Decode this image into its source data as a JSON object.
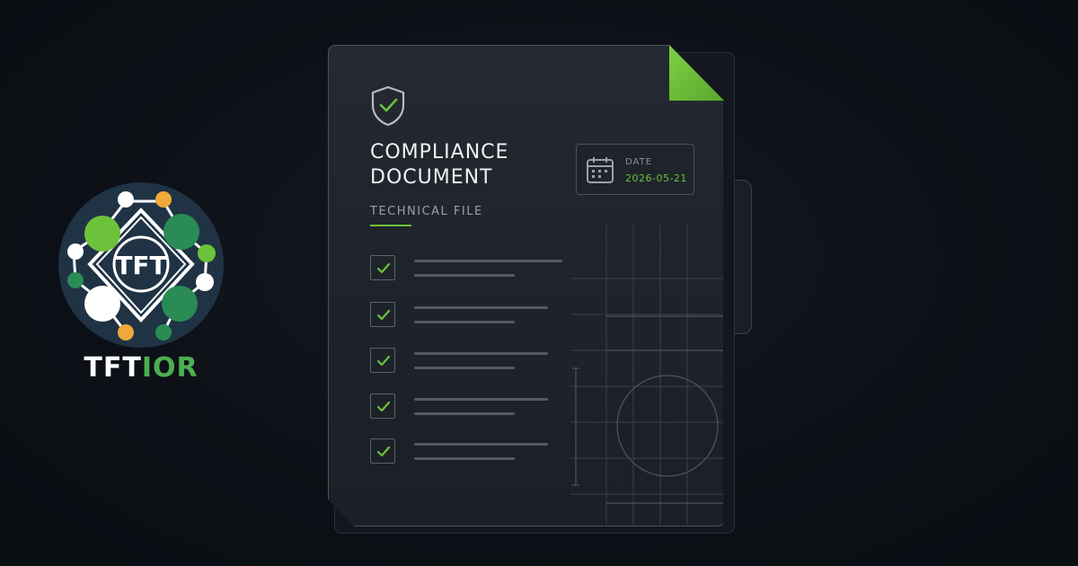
{
  "brand": {
    "logo_mark": "TFT",
    "name_white": "TFT",
    "name_green": "IOR"
  },
  "document": {
    "icon": "shield-check-icon",
    "title_line1": "COMPLIANCE",
    "title_line2": "DOCUMENT",
    "subtitle": "TECHNICAL FILE",
    "date": {
      "icon": "calendar-icon",
      "label": "DATE",
      "value": "2026-05-21"
    },
    "checklist": [
      {
        "checked": true
      },
      {
        "checked": true
      },
      {
        "checked": true
      },
      {
        "checked": true
      },
      {
        "checked": true
      }
    ]
  },
  "colors": {
    "background": "#0d1117",
    "accent_green": "#6cc23a",
    "brand_green": "#4caf50",
    "logo_circle": "#1f3344",
    "logo_orange": "#f0a93a"
  }
}
